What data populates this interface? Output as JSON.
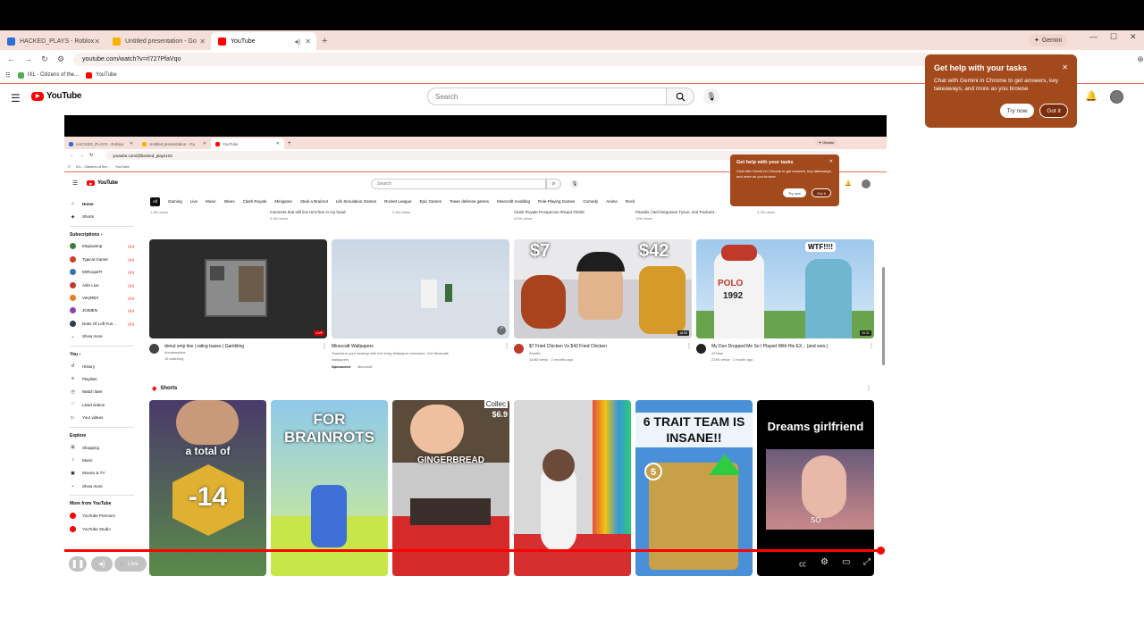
{
  "browser": {
    "tabs": [
      {
        "label": "HACKED_PLAYS - Roblox",
        "color": "#2c6fd6"
      },
      {
        "label": "Untitled presentation - Go",
        "color": "#f4b400"
      },
      {
        "label": "YouTube",
        "color": "#ff0000"
      }
    ],
    "gemini_chip": "Gemini",
    "url": "youtube.com/watch?v=rl727PfaVqo",
    "bookmarks": [
      "IXL - Citizens of the...",
      "YouTube"
    ]
  },
  "youtube": {
    "logo": "YouTube",
    "search_placeholder": "Search"
  },
  "gemini_popup": {
    "title": "Get help with your tasks",
    "text": "Chat with Gemini in Chrome to get answers, key takeaways, and more as you browse",
    "try_now": "Try now",
    "got_it": "Got it"
  },
  "inner": {
    "tabs": [
      {
        "label": "HACKED_PLAYS - Roblox",
        "color": "#2c6fd6"
      },
      {
        "label": "Untitled presentation - Go",
        "color": "#f4b400"
      },
      {
        "label": "YouTube",
        "color": "#ff0000"
      }
    ],
    "gemini_chip": "Gemini",
    "url": "youtube.com/@hacked_plays123",
    "bookmarks": [
      "IXL - Citizens of the...",
      "YouTube"
    ],
    "search_placeholder": "Search",
    "chips": [
      "All",
      "Gaming",
      "Live",
      "Music",
      "Mixes",
      "Clash Royale",
      "Minigame",
      "Steal a Brainrot",
      "Life Simulation Games",
      "Rocket League",
      "Epic Games",
      "Tower defense games",
      "Minecraft modding",
      "Role-Playing Games",
      "Comedy",
      "Anime",
      "Rock"
    ],
    "sidebar": {
      "main": [
        {
          "label": "Home",
          "icon": "home-icon",
          "glyph": "⌂"
        },
        {
          "label": "Shorts",
          "icon": "shorts-icon",
          "glyph": "◈"
        }
      ],
      "subscriptions_header": "Subscriptions  ›",
      "subscriptions": [
        {
          "label": "Mrgowamp",
          "color": "#3b7d3b"
        },
        {
          "label": "Typical Gamer",
          "color": "#d23b2a"
        },
        {
          "label": "MrRoopeFt",
          "color": "#3a6fb0"
        },
        {
          "label": "Adin Live",
          "color": "#c0392b"
        },
        {
          "label": "VeryRBX",
          "color": "#e67e22"
        },
        {
          "label": "JOIMEN",
          "color": "#8e44ad"
        },
        {
          "label": "Duke Of Loft Fun...",
          "color": "#2c3e50"
        }
      ],
      "show_more_1": "Show more",
      "you_header": "You  ›",
      "you": [
        {
          "label": "History",
          "glyph": "↺"
        },
        {
          "label": "Playlists",
          "glyph": "≡"
        },
        {
          "label": "Watch later",
          "glyph": "◷"
        },
        {
          "label": "Liked videos",
          "glyph": "♡"
        },
        {
          "label": "Your videos",
          "glyph": "▷"
        }
      ],
      "explore_header": "Explore",
      "explore": [
        {
          "label": "Shopping",
          "glyph": "⊞"
        },
        {
          "label": "Music",
          "glyph": "♪"
        },
        {
          "label": "Movies & TV",
          "glyph": "▣"
        }
      ],
      "show_more_2": "Show more",
      "more_header": "More from YouTube",
      "more": [
        {
          "label": "YouTube Premium",
          "color": "#ff0000"
        },
        {
          "label": "YouTube Studio",
          "color": "#ff0000"
        }
      ]
    },
    "top_meta": [
      "1.4M views",
      "moments that still live rent-free in my head",
      "9.0M views",
      "2.3M views",
      "Clash Royale Prospectus #Nup3 #2026",
      "224K views",
      "Paradis | Neil Degrasse Tyson, 2nd Podcast...",
      "12M views",
      "3.7M views"
    ],
    "videos": [
      {
        "title": "donut smp live | rating bases | Gambling",
        "channel": "donutsmplive",
        "stats": "16 watching",
        "badge": "LIVE"
      },
      {
        "title": "Minecraft Wallpapers",
        "channel": "Transform your desktop with the living Wallpaper extension. Get Minecraft",
        "stats": "wallpapers",
        "sponsor": "Sponsored",
        "sponsor_by": "Microsoft"
      },
      {
        "title": "$7 Fried Chicken Vs $42 Fried Chicken",
        "channel": "Zerelfe",
        "stats": "144M views · 2 months ago",
        "duration": "18:53",
        "overlay_left": "$7",
        "overlay_right": "$42"
      },
      {
        "title": "My Duo Dropped Me So I Played With His EX... (and won.)",
        "channel": "AThiles",
        "stats": "225K views · 1 month ago",
        "duration": "20:31",
        "overlay": "WTF!!!!",
        "polo": "POLO",
        "year": "1992"
      }
    ],
    "shorts_header": "Shorts",
    "shorts": [
      {
        "caption": "a total of",
        "caption2": "-14"
      },
      {
        "caption": "FOR BRAINROTS"
      },
      {
        "caption": "GINGERBREAD",
        "corner": "Collec",
        "price": "$6.9"
      },
      {
        "caption": ""
      },
      {
        "caption": "6 TRAIT TEAM IS INSANE!!",
        "level": "5"
      },
      {
        "caption": "Dreams girlfriend",
        "tag": "SO"
      }
    ],
    "gemini": {
      "title": "Get help with your tasks",
      "text": "Chat with Gemini in Chrome to get answers, key takeaways, and more as you browse",
      "try_now": "Try now",
      "got_it": "Got it"
    }
  },
  "player": {
    "live_label": "Live",
    "progress_percent": 100
  }
}
